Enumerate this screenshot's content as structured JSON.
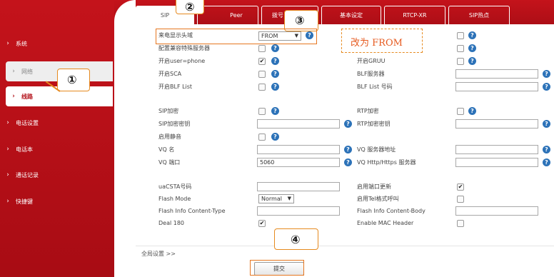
{
  "sidebar": {
    "items": [
      {
        "label": "系统"
      },
      {
        "label": "网络"
      },
      {
        "label": "线路"
      },
      {
        "label": "电话设置"
      },
      {
        "label": "电话本"
      },
      {
        "label": "通话记录"
      },
      {
        "label": "快捷键"
      }
    ]
  },
  "tabs": [
    {
      "label": "SIP"
    },
    {
      "label": "Peer"
    },
    {
      "label": "拨号"
    },
    {
      "label": "基本设定"
    },
    {
      "label": "RTCP-XR"
    },
    {
      "label": "SIP热点"
    }
  ],
  "form": {
    "left": {
      "caller_id_header": {
        "label": "来电显示头域",
        "value": "FROM"
      },
      "special_server": {
        "label": "配置兼容特殊服务器"
      },
      "user_phone": {
        "label": "开启user=phone"
      },
      "sca": {
        "label": "开启SCA"
      },
      "blf_list": {
        "label": "开启BLF List"
      },
      "sip_encrypt": {
        "label": "SIP加密"
      },
      "sip_key": {
        "label": "SIP加密密钥"
      },
      "mute": {
        "label": "启用静音"
      },
      "vq_name": {
        "label": "VQ 名"
      },
      "vq_port": {
        "label": "VQ 端口",
        "value": "5060"
      },
      "uacsta": {
        "label": "uaCSTA号码"
      },
      "flash_mode": {
        "label": "Flash Mode",
        "value": "Normal"
      },
      "flash_info_type": {
        "label": "Flash Info Content-Type"
      },
      "deal_180": {
        "label": "Deal 180"
      }
    },
    "right": {
      "gruu": {
        "label": "开启GRUU"
      },
      "blf_server": {
        "label": "BLF服务器"
      },
      "blf_list_number": {
        "label": "BLF List 号码"
      },
      "rtp_encrypt": {
        "label": "RTP加密"
      },
      "rtp_key": {
        "label": "RTP加密密钥"
      },
      "vq_server": {
        "label": "VQ 服务器地址"
      },
      "vq_http": {
        "label": "VQ Http/Https 服务器"
      },
      "port_update": {
        "label": "启用端口更新"
      },
      "tel_call": {
        "label": "启用Tel格式呼叫"
      },
      "flash_info_body": {
        "label": "Flash Info Content-Body"
      },
      "mac_header": {
        "label": "Enable MAC Header"
      }
    }
  },
  "checks": {
    "special_server": false,
    "user_phone": true,
    "sca": false,
    "blf_list": false,
    "sip_encrypt": false,
    "mute": false,
    "deal_180": true,
    "top_right_1": false,
    "top_right_2": false,
    "gruu": false,
    "rtp_encrypt": false,
    "port_update": true,
    "tel_call": false,
    "mac_header": false
  },
  "global_settings_link": "全局设置 >>",
  "submit_label": "提交",
  "annotations": {
    "circle_1": "①",
    "circle_2": "②",
    "circle_3": "③",
    "circle_4": "④",
    "callout_text": "改为 FROM"
  },
  "colors": {
    "brand_red": "#b3121a",
    "help_blue": "#2c72b8",
    "annotation_orange": "#e68a1f"
  }
}
